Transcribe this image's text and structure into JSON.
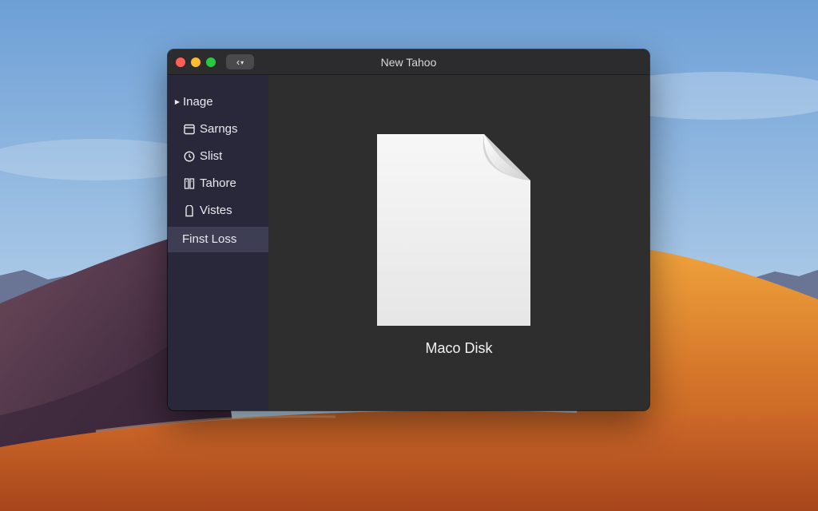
{
  "window": {
    "title": "New Tahoo",
    "back_label": "‹",
    "back_dropdown": "▾"
  },
  "sidebar": {
    "items": [
      {
        "label": "Inage",
        "icon": "disclosure-triangle-icon"
      },
      {
        "label": "Sarngs",
        "icon": "calendar-icon"
      },
      {
        "label": "Slist",
        "icon": "clock-icon"
      },
      {
        "label": "Tahore",
        "icon": "columns-icon"
      },
      {
        "label": "Vistes",
        "icon": "tag-icon"
      },
      {
        "label": "Finst Loss",
        "selected": true
      }
    ]
  },
  "content": {
    "file_name": "Maco Disk",
    "file_icon": "document-icon"
  },
  "colors": {
    "close": "#ff5f57",
    "minimize": "#febc2e",
    "zoom": "#28c840",
    "sidebar_bg": "#28283a",
    "selected_bg": "#3d3d54",
    "content_bg": "#2e2e2e"
  }
}
